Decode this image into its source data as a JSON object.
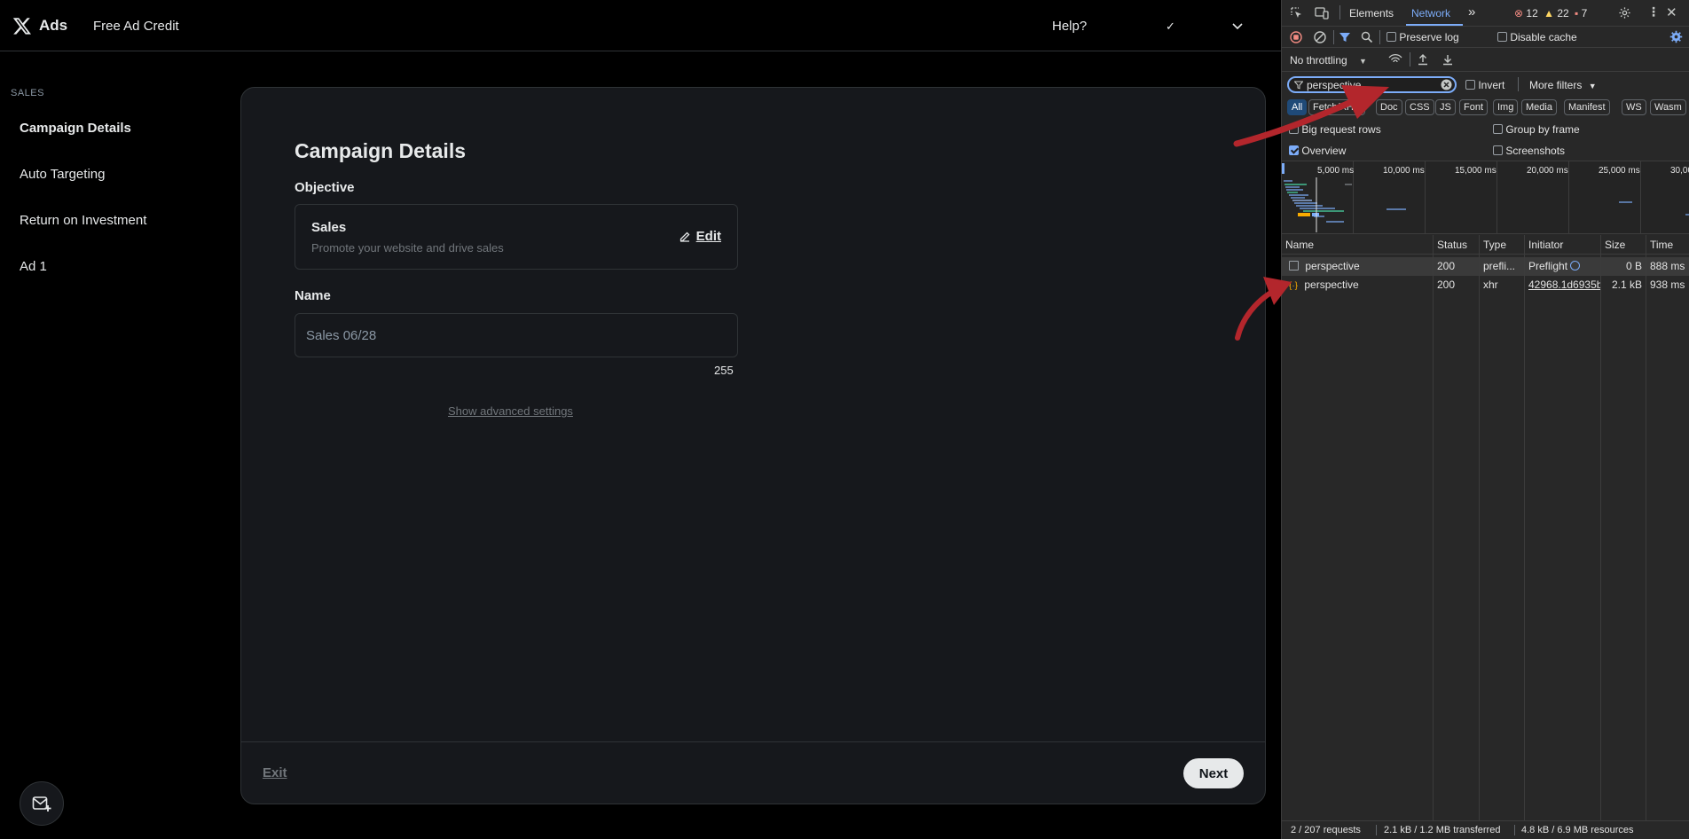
{
  "app": {
    "brand": "Ads",
    "credit": "Free Ad Credit",
    "help": "Help?",
    "chevron_1": "⌄",
    "chevron_2": "⌄",
    "sidebar": {
      "heading": "SALES",
      "items": [
        {
          "label": "Campaign Details"
        },
        {
          "label": "Auto Targeting"
        },
        {
          "label": "Return on Investment"
        },
        {
          "label": "Ad 1"
        }
      ]
    },
    "card": {
      "title": "Campaign Details",
      "objective_label": "Objective",
      "objective_title": "Sales",
      "objective_desc": "Promote your website and drive sales",
      "edit_label": "Edit",
      "name_label": "Name",
      "name_value": "Sales 06/28",
      "char_count": "255",
      "advanced": "Show advanced settings",
      "exit": "Exit",
      "next": "Next"
    }
  },
  "devtools": {
    "tabs": [
      "Elements",
      "Network"
    ],
    "more_tabs": "»",
    "errors": "12",
    "warnings": "22",
    "messages": "7",
    "preserve_log": "Preserve log",
    "disable_cache": "Disable cache",
    "throttling": "No throttling",
    "filter_value": "perspective",
    "invert": "Invert",
    "more_filters": "More filters",
    "chips": [
      "All",
      "Fetch/XHR",
      "Doc",
      "CSS",
      "JS",
      "Font",
      "Img",
      "Media",
      "Manifest",
      "WS",
      "Wasm"
    ],
    "big_request_rows": "Big request rows",
    "group_by_frame": "Group by frame",
    "overview": "Overview",
    "screenshots": "Screenshots",
    "timeline_ticks": [
      "5,000 ms",
      "10,000 ms",
      "15,000 ms",
      "20,000 ms",
      "25,000 ms",
      "30,00"
    ],
    "columns": [
      "Name",
      "Status",
      "Type",
      "Initiator",
      "Size",
      "Time"
    ],
    "requests": [
      {
        "name": "perspective",
        "status": "200",
        "type": "prefli...",
        "initiator": "Preflight",
        "size": "0 B",
        "time": "888 ms"
      },
      {
        "name": "perspective",
        "status": "200",
        "type": "xhr",
        "initiator": "42968.1d6935b",
        "size": "2.1 kB",
        "time": "938 ms"
      }
    ],
    "status_requests": "2 / 207 requests",
    "status_transferred": "2.1 kB / 1.2 MB transferred",
    "status_resources": "4.8 kB / 6.9 MB resources"
  },
  "colors": {
    "accent": "#7cacf8",
    "annotation_arrow": "#b3262c",
    "error": "#f28b82",
    "warning": "#fdd663"
  }
}
